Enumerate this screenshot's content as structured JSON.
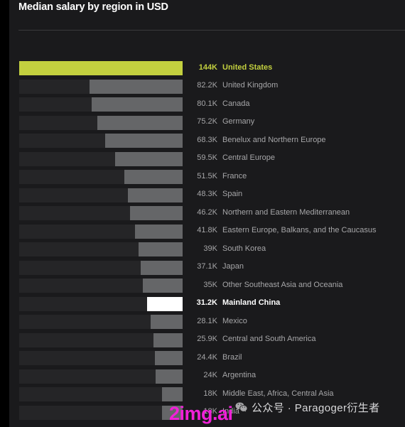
{
  "panel": {
    "title": "Median salary by region in USD"
  },
  "chart_data": {
    "type": "bar",
    "title": "Median salary by region in USD",
    "xlabel": "",
    "ylabel": "",
    "orientation": "horizontal",
    "grid": false,
    "legend": null,
    "value_unit": "USD",
    "xlim": [
      0,
      144000
    ],
    "categories": [
      "United States",
      "United Kingdom",
      "Canada",
      "Germany",
      "Benelux and Northern Europe",
      "Central Europe",
      "France",
      "Spain",
      "Northern and Eastern Mediterranean",
      "Eastern Europe, Balkans, and the Caucasus",
      "South Korea",
      "Japan",
      "Other Southeast Asia and Oceania",
      "Mainland China",
      "Mexico",
      "Central and South America",
      "Brazil",
      "Argentina",
      "Middle East, Africa, Central Asia",
      "India"
    ],
    "values": [
      144000,
      82200,
      80100,
      75200,
      68300,
      59500,
      51500,
      48300,
      46200,
      41800,
      39000,
      37100,
      35000,
      31200,
      28100,
      25900,
      24400,
      24000,
      18000,
      18000
    ],
    "value_labels": [
      "144K",
      "82.2K",
      "80.1K",
      "75.2K",
      "68.3K",
      "59.5K",
      "51.5K",
      "48.3K",
      "46.2K",
      "41.8K",
      "39K",
      "37.1K",
      "35K",
      "31.2K",
      "28.1K",
      "25.9K",
      "24.4K",
      "24K",
      "18K",
      "18K"
    ],
    "bar_styles": [
      "accent",
      "normal",
      "normal",
      "normal",
      "normal",
      "normal",
      "normal",
      "normal",
      "normal",
      "normal",
      "normal",
      "normal",
      "normal",
      "highlight",
      "normal",
      "normal",
      "normal",
      "normal",
      "normal",
      "normal"
    ],
    "colors": {
      "accent": "#c3d03f",
      "highlight": "#ffffff",
      "bar": "#656668",
      "track": "#252527",
      "background": "#1a1a1c",
      "text": "#a6a6a8"
    }
  },
  "watermarks": {
    "brand": "2img.ai",
    "wechat": "公众号 · Paragoger衍生者",
    "wechat_icon": "wechat-icon"
  }
}
